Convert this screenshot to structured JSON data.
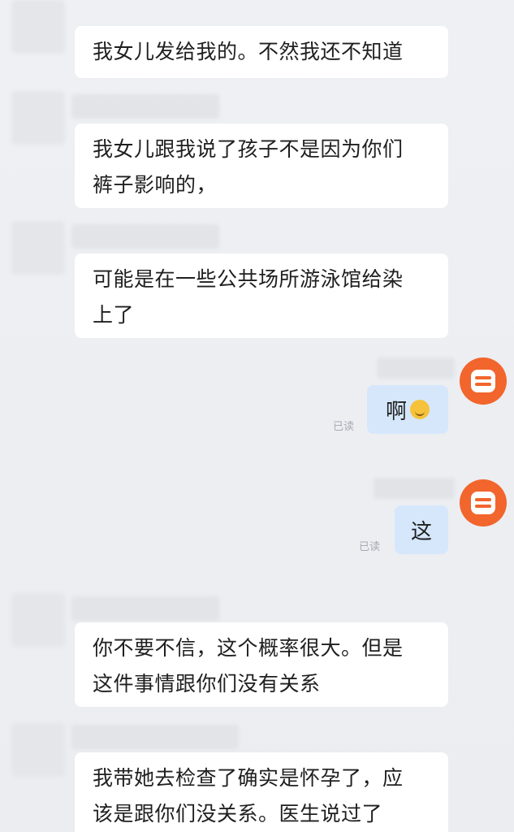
{
  "messages": [
    {
      "side": "in",
      "text_lines": [
        "我女儿发给我的。不然我还不知道"
      ]
    },
    {
      "side": "in",
      "text_lines": [
        "我女儿跟我说了孩子不是因为你们",
        "裤子影响的，"
      ]
    },
    {
      "side": "in",
      "text_lines": [
        "可能是在一些公共场所游泳馆给染",
        "上了"
      ]
    },
    {
      "side": "out",
      "text": "啊",
      "emoji": "smiling-face-icon",
      "status": "已读"
    },
    {
      "side": "out",
      "text": "这",
      "status": "已读"
    },
    {
      "side": "in",
      "text_lines": [
        "你不要不信，这个概率很大。但是",
        "这件事情跟你们没有关系"
      ]
    },
    {
      "side": "in",
      "text_lines": [
        "我带她去检查了确实是怀孕了，应",
        "该是跟你们没关系。医生说过了"
      ]
    }
  ],
  "colors": {
    "background": "#eceef2",
    "incoming_bubble": "#ffffff",
    "outgoing_bubble": "#d6e7fb",
    "avatar_accent": "#f2652c"
  }
}
